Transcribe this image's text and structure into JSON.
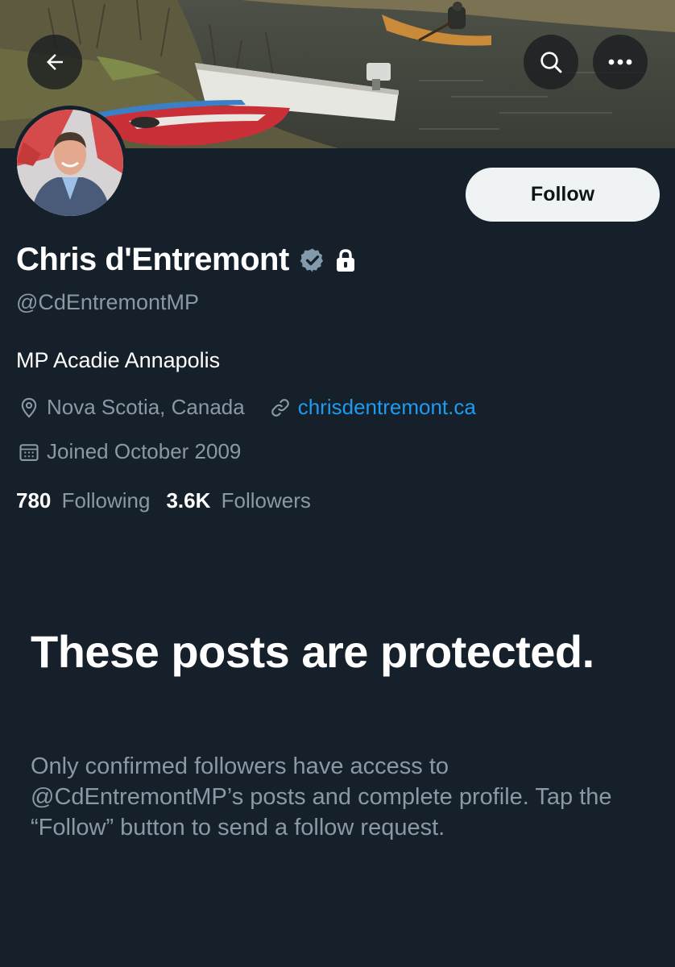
{
  "header": {
    "back_icon": "arrow-left-icon",
    "search_icon": "search-icon",
    "more_icon": "more-horizontal-icon"
  },
  "profile": {
    "display_name": "Chris d'Entremont",
    "verified_icon": "verified-badge-icon",
    "protected_icon": "lock-icon",
    "handle": "@CdEntremontMP",
    "bio": "MP Acadie Annapolis",
    "location": "Nova Scotia, Canada",
    "location_icon": "location-pin-icon",
    "website": "chrisdentremont.ca",
    "website_icon": "link-icon",
    "joined": "Joined October 2009",
    "joined_icon": "calendar-icon",
    "following_count": "780",
    "following_label": "Following",
    "followers_count": "3.6K",
    "followers_label": "Followers",
    "follow_button_label": "Follow"
  },
  "protected_notice": {
    "title": "These posts are protected.",
    "body": "Only confirmed followers have access to @CdEntremontMP’s posts and complete profile. Tap the “Follow” button to send a follow request."
  },
  "colors": {
    "background": "#15202b",
    "primary_text": "#ffffff",
    "secondary_text": "#8b98a5",
    "link": "#1d9bf0",
    "button_bg": "#eff3f4"
  }
}
